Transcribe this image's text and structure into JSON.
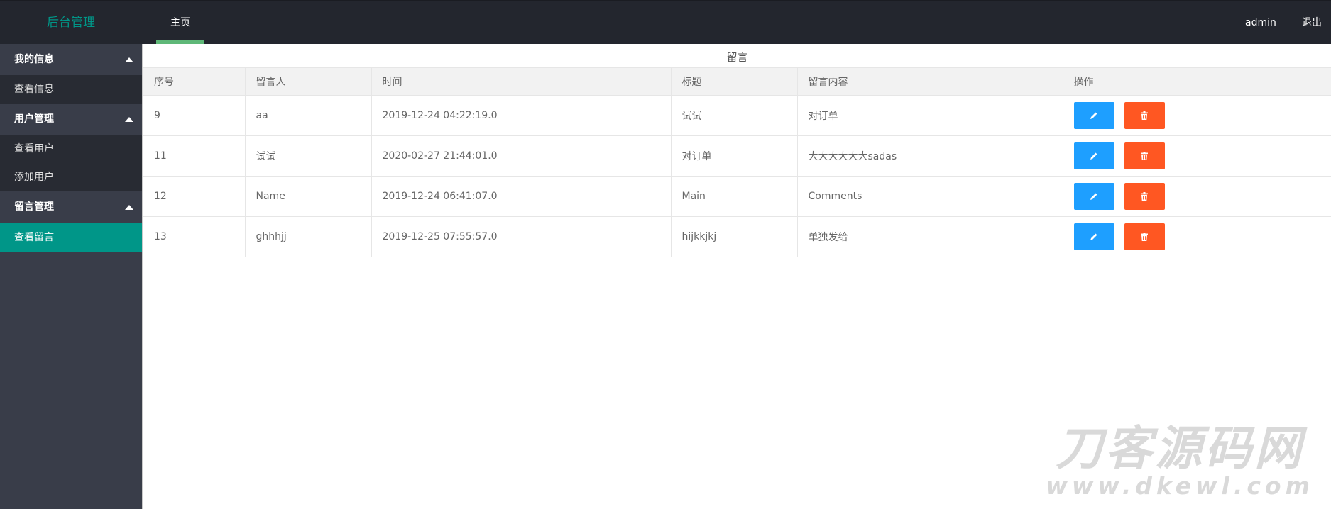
{
  "header": {
    "logo": "后台管理",
    "nav_tab": "主页",
    "user": "admin",
    "logout": "退出"
  },
  "sidebar": {
    "groups": [
      {
        "label": "我的信息",
        "items": [
          "查看信息"
        ]
      },
      {
        "label": "用户管理",
        "items": [
          "查看用户",
          "添加用户"
        ]
      },
      {
        "label": "留言管理",
        "items": [
          "查看留言"
        ]
      }
    ],
    "active_item": "查看留言"
  },
  "table": {
    "caption": "留言",
    "columns": [
      "序号",
      "留言人",
      "时间",
      "标题",
      "留言内容",
      "操作"
    ],
    "rows": [
      [
        "9",
        "aa",
        "2019-12-24 04:22:19.0",
        "试试",
        "对订单"
      ],
      [
        "11",
        "试试",
        "2020-02-27 21:44:01.0",
        "对订单",
        "大大大大大大sadas"
      ],
      [
        "12",
        "Name",
        "2019-12-24 06:41:07.0",
        "Main",
        "Comments"
      ],
      [
        "13",
        "ghhhjj",
        "2019-12-25 07:55:57.0",
        "hijkkjkj",
        "单独发给"
      ]
    ]
  },
  "icons": {
    "edit": "pencil-icon",
    "delete": "trash-icon"
  },
  "colors": {
    "header_bg": "#23262e",
    "sidebar_bg": "#393d49",
    "accent": "#009688",
    "edit_btn": "#1e9fff",
    "delete_btn": "#ff5722"
  },
  "watermark": {
    "title": "刀客源码网",
    "url": "www.dkewl.com"
  }
}
